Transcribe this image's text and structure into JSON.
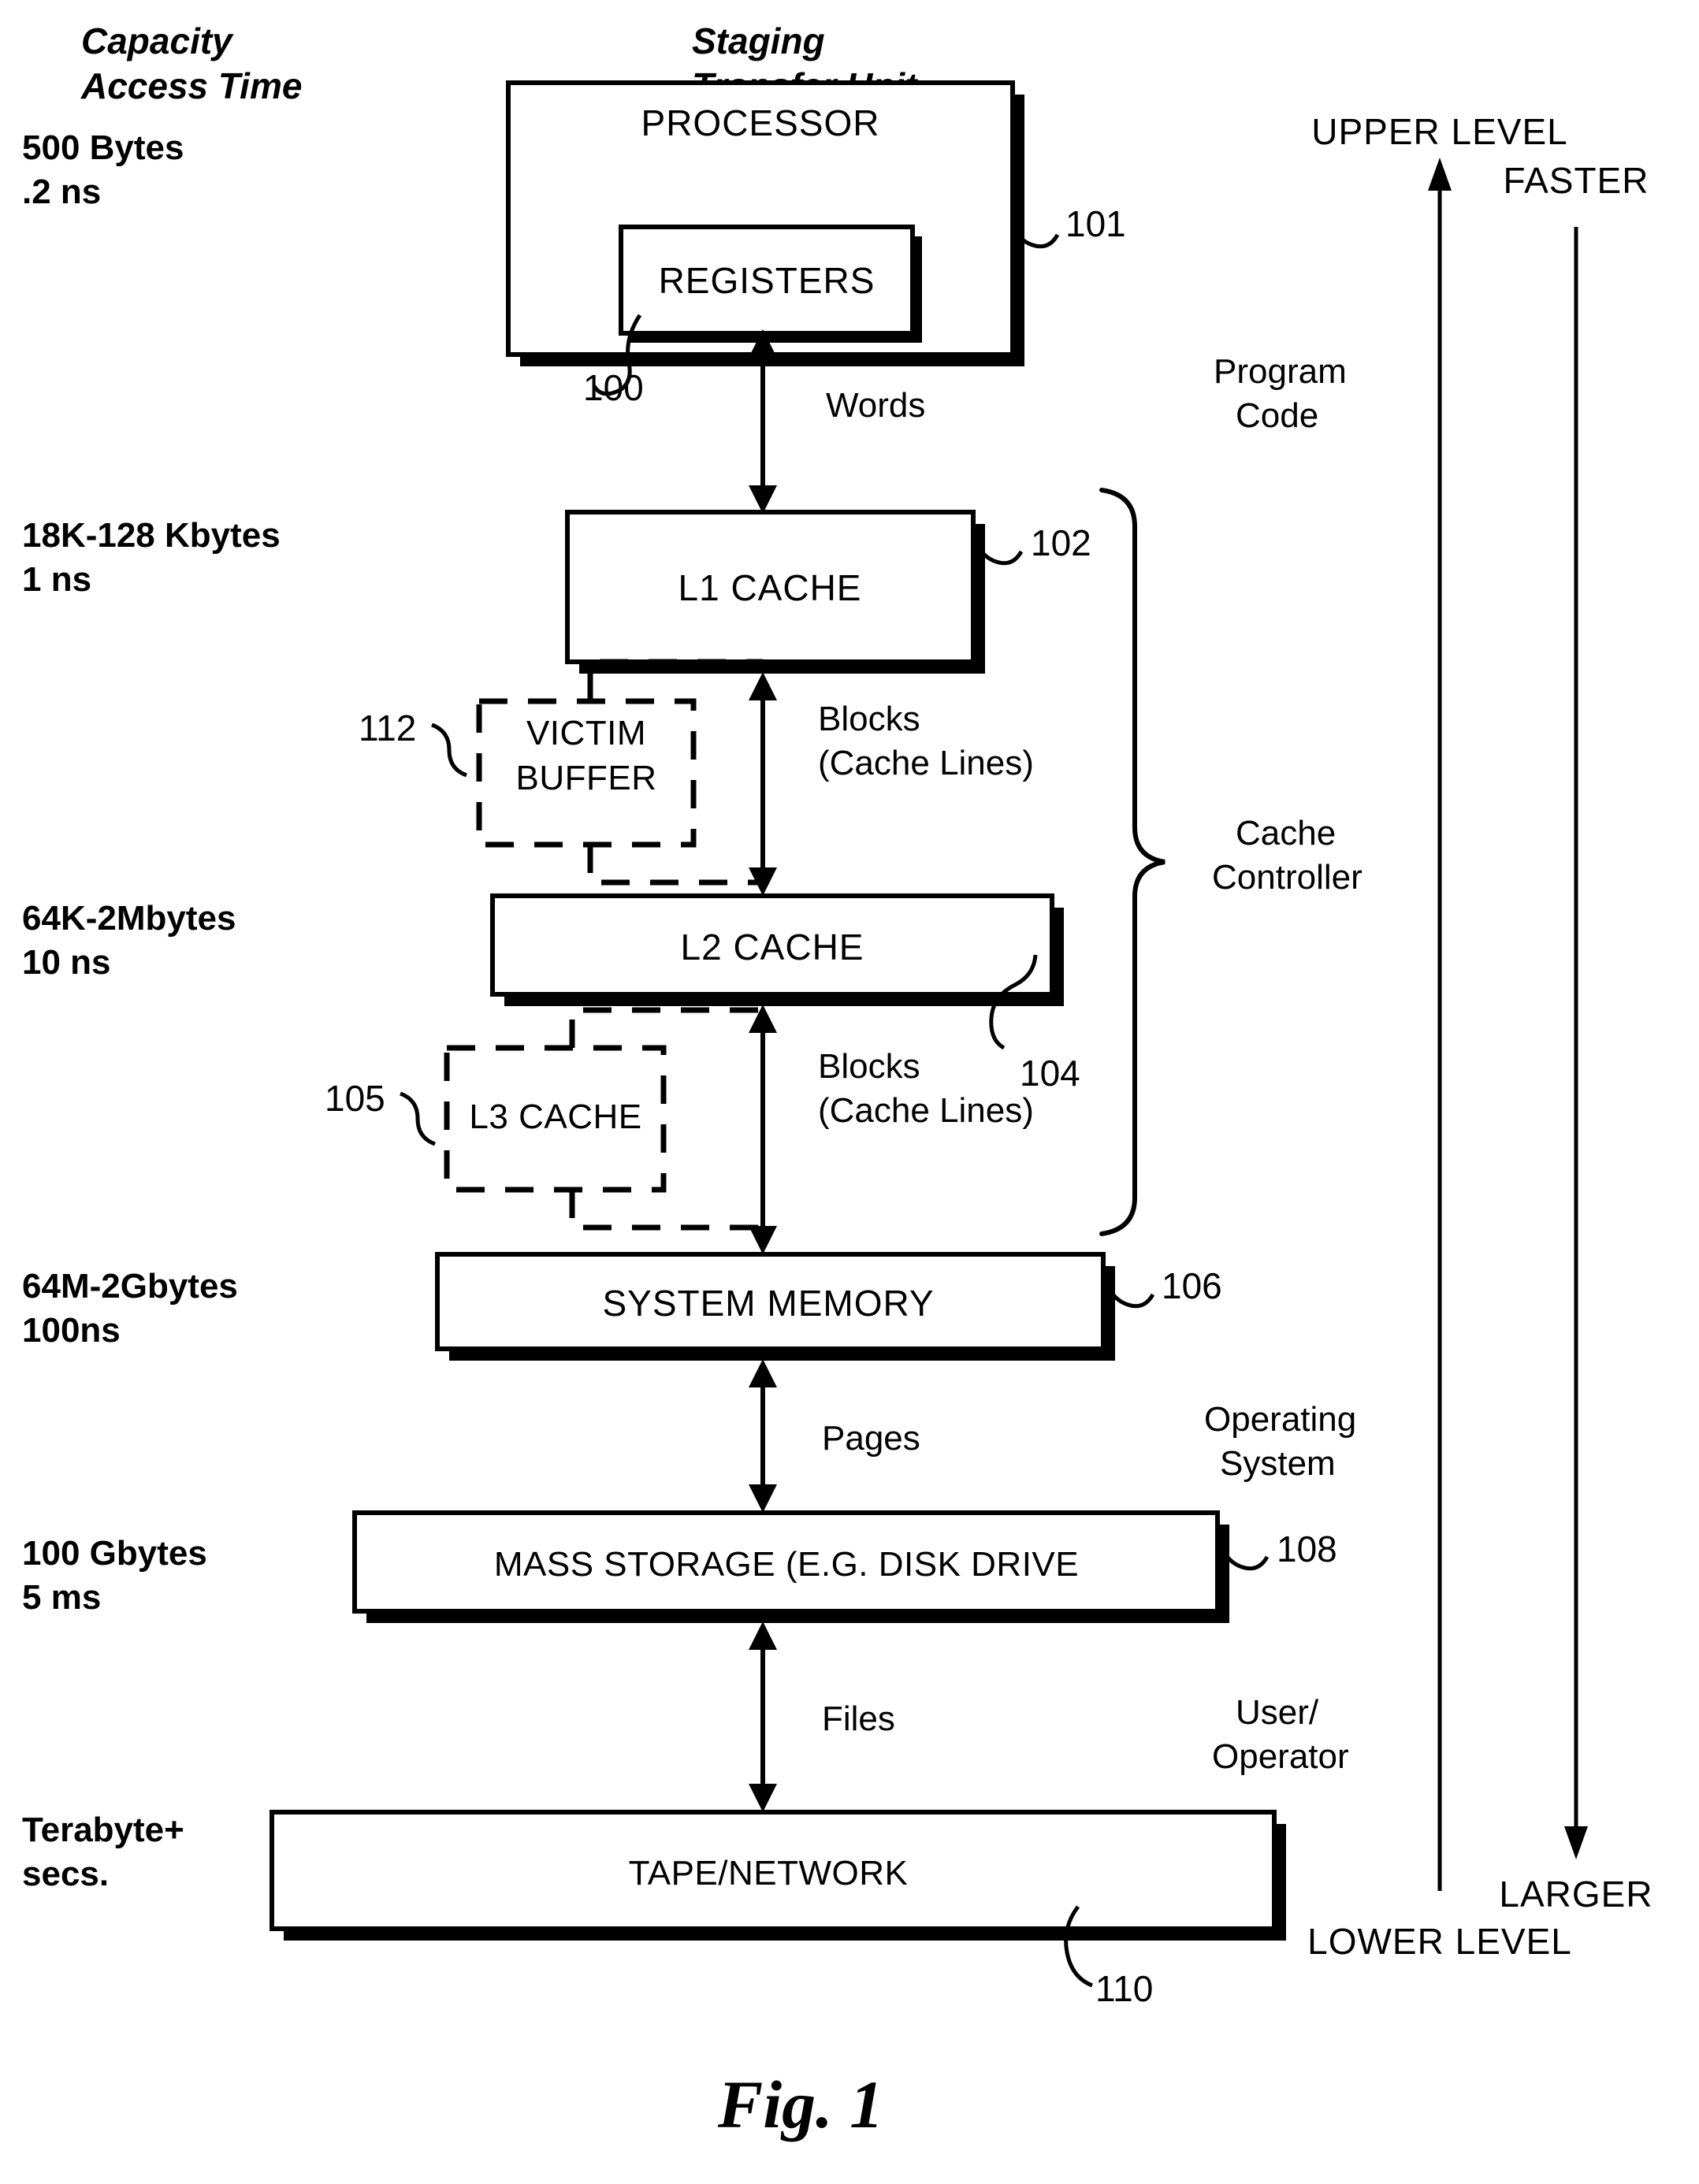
{
  "figure": {
    "caption": "Fig. 1",
    "left_column_header": {
      "line1": "Capacity",
      "line2": "Access Time"
    },
    "right_column_header": {
      "line1": "Staging",
      "line2": "Transfer Unit"
    }
  },
  "capacity_rows": [
    {
      "size": "500 Bytes",
      "time": ".2 ns"
    },
    {
      "size": "18K-128 Kbytes",
      "time": "1 ns"
    },
    {
      "size": "64K-2Mbytes",
      "time": "10 ns"
    },
    {
      "size": "64M-2Gbytes",
      "time": "100ns"
    },
    {
      "size": "100 Gbytes",
      "time": "5 ms"
    },
    {
      "size": "Terabyte+",
      "time": "secs."
    }
  ],
  "boxes": {
    "processor": {
      "label": "PROCESSOR",
      "ref": "101"
    },
    "registers": {
      "label": "REGISTERS",
      "ref": "100"
    },
    "l1_cache": {
      "label": "L1 CACHE",
      "ref": "102"
    },
    "victim_buffer": {
      "label_line1": "VICTIM",
      "label_line2": "BUFFER",
      "ref": "112"
    },
    "l2_cache": {
      "label": "L2 CACHE",
      "ref": "104"
    },
    "l3_cache": {
      "label": "L3 CACHE",
      "ref": "105"
    },
    "system_memory": {
      "label": "SYSTEM MEMORY",
      "ref": "106"
    },
    "mass_storage": {
      "label": "MASS STORAGE (E.G. DISK DRIVE",
      "ref": "108"
    },
    "tape_network": {
      "label": "TAPE/NETWORK",
      "ref": "110"
    }
  },
  "transfer_units": [
    {
      "label": "Words"
    },
    {
      "label_line1": "Blocks",
      "label_line2": "(Cache Lines)"
    },
    {
      "label_line1": "Blocks",
      "label_line2": "(Cache Lines)"
    },
    {
      "label": "Pages"
    },
    {
      "label": "Files"
    }
  ],
  "staging_labels": {
    "program_code_line1": "Program",
    "program_code_line2": "Code",
    "cache_controller_line1": "Cache",
    "cache_controller_line2": "Controller",
    "operating_system_line1": "Operating",
    "operating_system_line2": "System",
    "user_operator_line1": "User/",
    "user_operator_line2": "Operator"
  },
  "level_axis": {
    "upper_level": "UPPER LEVEL",
    "lower_level": "LOWER LEVEL",
    "faster": "FASTER",
    "larger": "LARGER"
  },
  "colors": {
    "ink": "#000000",
    "paper": "#ffffff"
  }
}
